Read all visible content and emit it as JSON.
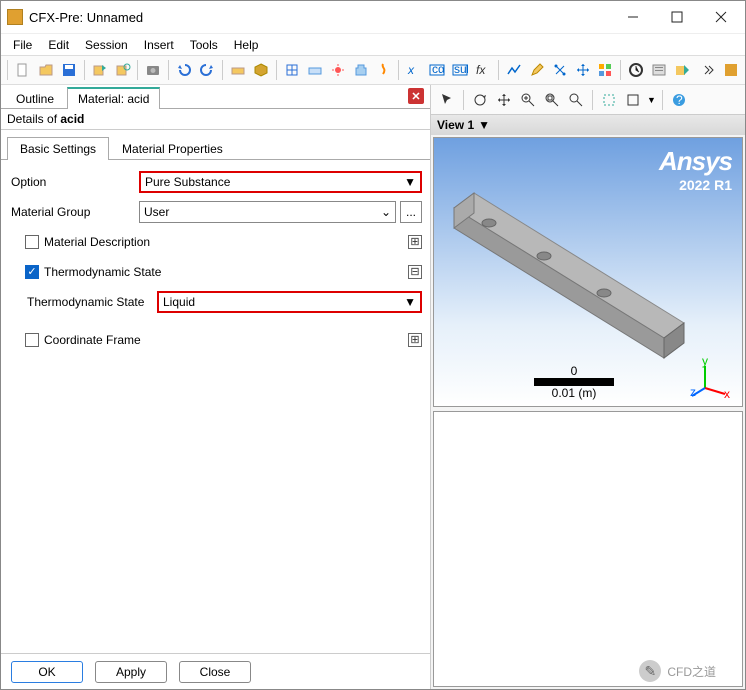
{
  "window": {
    "title": "CFX-Pre:  Unnamed"
  },
  "menus": {
    "file": "File",
    "edit": "Edit",
    "session": "Session",
    "insert": "Insert",
    "tools": "Tools",
    "help": "Help"
  },
  "toptabs": {
    "outline": "Outline",
    "material": "Material: acid"
  },
  "details_prefix": "Details of ",
  "details_name": "acid",
  "subtabs": {
    "basic": "Basic Settings",
    "matprops": "Material Properties"
  },
  "form": {
    "option_label": "Option",
    "option_value": "Pure Substance",
    "group_label": "Material Group",
    "group_value": "User",
    "more": "...",
    "mat_desc": "Material Description",
    "thermo_state_chk": "Thermodynamic State",
    "thermo_state_label": "Thermodynamic State",
    "thermo_state_value": "Liquid",
    "coord_frame": "Coordinate Frame"
  },
  "buttons": {
    "ok": "OK",
    "apply": "Apply",
    "close": "Close"
  },
  "view": {
    "header": "View 1",
    "scale_zero": "0",
    "scale_val": "0.01 (m)",
    "ansys": "Ansys",
    "version": "2022 R1"
  },
  "watermark": "CFD之道"
}
